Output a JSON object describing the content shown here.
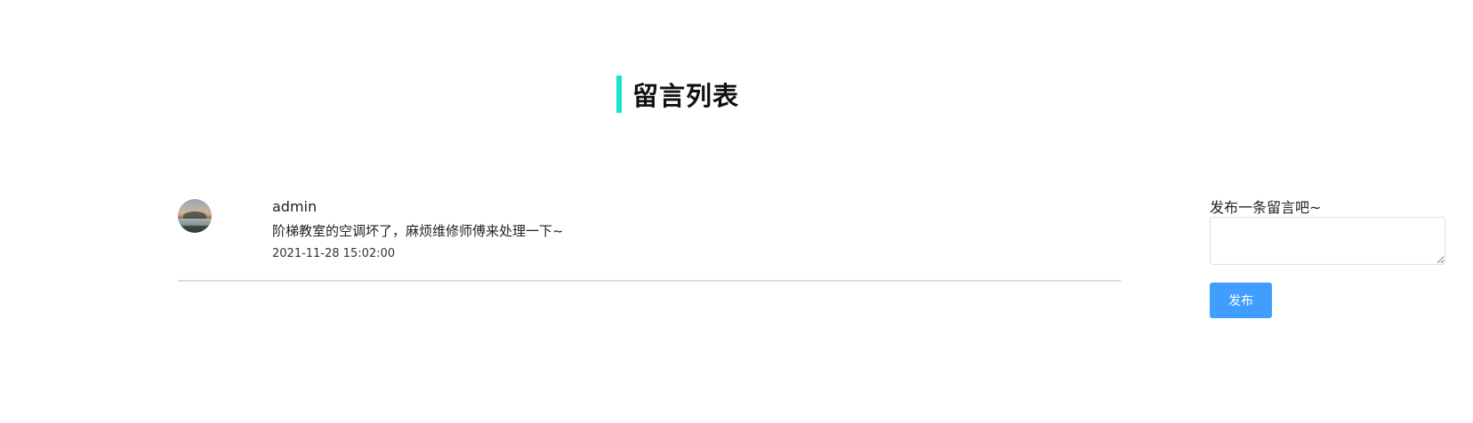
{
  "header": {
    "title": "留言列表",
    "accent_color": "#19e3c9"
  },
  "comments": [
    {
      "username": "admin",
      "content": "阶梯教室的空调坏了，麻烦维修师傅来处理一下~",
      "time": "2021-11-28 15:02:00"
    }
  ],
  "sidebar": {
    "label": "发布一条留言吧~",
    "textarea_value": "",
    "publish_label": "发布",
    "button_color": "#409eff"
  }
}
